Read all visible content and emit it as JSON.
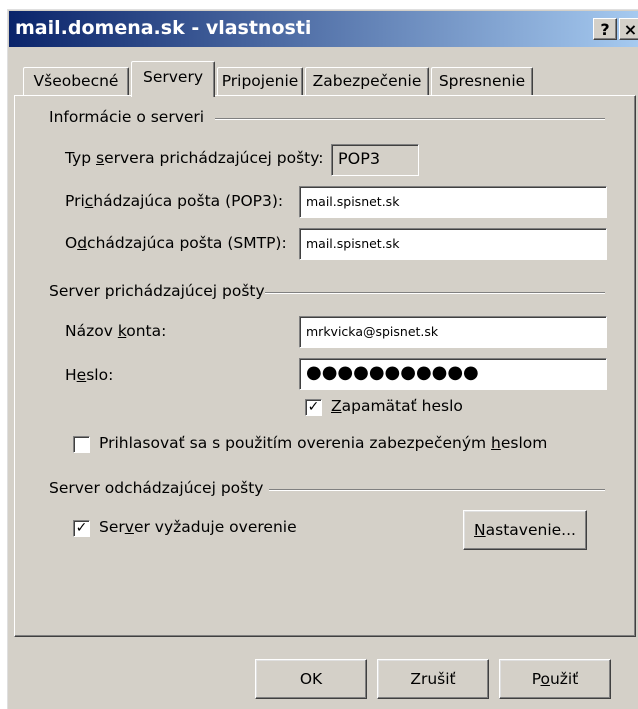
{
  "window": {
    "title": "mail.domena.sk - vlastnosti",
    "help_button": "?",
    "close_button": "×"
  },
  "tabs": [
    {
      "label": "Všeobecné",
      "active": false
    },
    {
      "label": "Servery",
      "active": true
    },
    {
      "label": "Pripojenie",
      "active": false
    },
    {
      "label": "Zabezpečenie",
      "active": false
    },
    {
      "label": "Spresnenie",
      "active": false
    }
  ],
  "server_info": {
    "group_title": "Informácie o serveri",
    "type_label_pre": "Typ ",
    "type_label_ul": "s",
    "type_label_post": "ervera prichádzajúcej pošty:",
    "type_value": "POP3",
    "incoming_label_pre": "Pri",
    "incoming_label_ul": "c",
    "incoming_label_post": "hádzajúca pošta (POP3):",
    "incoming_value": "mail.spisnet.sk",
    "outgoing_label_pre": "O",
    "outgoing_label_ul": "d",
    "outgoing_label_post": "chádzajúca pošta (SMTP):",
    "outgoing_value": "mail.spisnet.sk"
  },
  "incoming_server": {
    "group_title": "Server prichádzajúcej pošty",
    "account_label_pre": "Názov ",
    "account_label_ul": "k",
    "account_label_post": "onta:",
    "account_value": "mrkvicka@spisnet.sk",
    "password_label_pre": "H",
    "password_label_ul": "e",
    "password_label_post": "slo:",
    "password_value": "●●●●●●●●●●●",
    "remember_checked": true,
    "remember_label_ul": "Z",
    "remember_label_post": "apamätať heslo",
    "spa_checked": false,
    "spa_label_pre": "Prihlasovať sa s použitím overenia zabezpečeným ",
    "spa_label_ul": "h",
    "spa_label_post": "eslom"
  },
  "outgoing_server": {
    "group_title": "Server odchádzajúcej pošty",
    "auth_checked": true,
    "auth_label_pre": "Ser",
    "auth_label_ul": "v",
    "auth_label_post": "er vyžaduje overenie",
    "settings_button_ul": "N",
    "settings_button_post": "astavenie..."
  },
  "buttons": {
    "ok": "OK",
    "cancel": "Zrušiť",
    "apply_pre": "P",
    "apply_ul": "o",
    "apply_post": "užiť"
  }
}
